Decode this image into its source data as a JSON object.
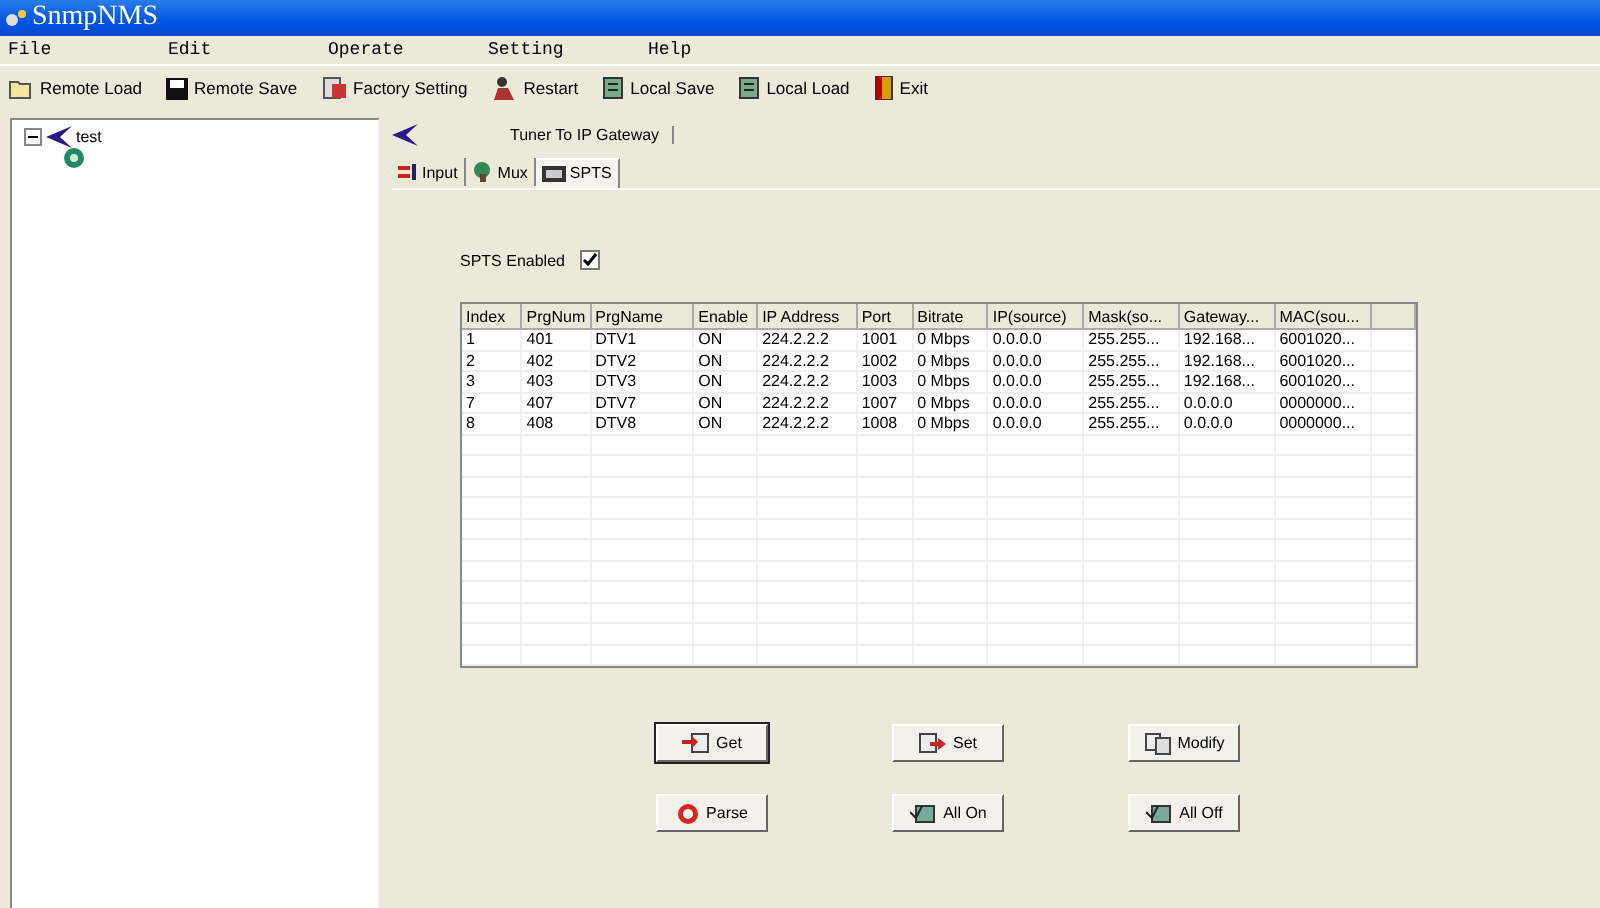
{
  "window": {
    "title": "SnmpNMS"
  },
  "menu": [
    "File",
    "Edit",
    "Operate",
    "Setting",
    "Help"
  ],
  "toolbar": [
    {
      "label": "Remote Load",
      "kind": "folder"
    },
    {
      "label": "Remote Save",
      "kind": "disk"
    },
    {
      "label": "Factory Setting",
      "kind": "factory"
    },
    {
      "label": "Restart",
      "kind": "restart"
    },
    {
      "label": "Local Save",
      "kind": "local"
    },
    {
      "label": "Local Load",
      "kind": "local"
    },
    {
      "label": "Exit",
      "kind": "exit"
    }
  ],
  "tree": [
    {
      "label": "test",
      "expanded": true,
      "children": [
        {
          "kind": "device"
        }
      ]
    }
  ],
  "device_tab": {
    "label": "Tuner To IP Gateway"
  },
  "tabs": [
    {
      "label": "Input",
      "selected": false
    },
    {
      "label": "Mux",
      "selected": false
    },
    {
      "label": "SPTS",
      "selected": true
    }
  ],
  "spts_enabled": {
    "label": "SPTS Enabled",
    "checked": true
  },
  "table": {
    "columns": [
      "Index",
      "PrgNum",
      "PrgName",
      "Enable",
      "IP Address",
      "Port",
      "Bitrate",
      "IP(source)",
      "Mask(so...",
      "Gateway...",
      "MAC(sou..."
    ],
    "rows": [
      [
        "1",
        "401",
        "DTV1",
        "ON",
        "224.2.2.2",
        "1001",
        "0 Mbps",
        "0.0.0.0",
        "255.255...",
        "192.168...",
        "6001020..."
      ],
      [
        "2",
        "402",
        "DTV2",
        "ON",
        "224.2.2.2",
        "1002",
        "0 Mbps",
        "0.0.0.0",
        "255.255...",
        "192.168...",
        "6001020..."
      ],
      [
        "3",
        "403",
        "DTV3",
        "ON",
        "224.2.2.2",
        "1003",
        "0 Mbps",
        "0.0.0.0",
        "255.255...",
        "192.168...",
        "6001020..."
      ],
      [
        "7",
        "407",
        "DTV7",
        "ON",
        "224.2.2.2",
        "1007",
        "0 Mbps",
        "0.0.0.0",
        "255.255...",
        "0.0.0.0",
        "0000000..."
      ],
      [
        "8",
        "408",
        "DTV8",
        "ON",
        "224.2.2.2",
        "1008",
        "0 Mbps",
        "0.0.0.0",
        "255.255...",
        "0.0.0.0",
        "0000000..."
      ]
    ]
  },
  "buttons": [
    {
      "label": "Get",
      "kind": "get",
      "focused": true
    },
    {
      "label": "Set",
      "kind": "set",
      "focused": false
    },
    {
      "label": "Modify",
      "kind": "modify",
      "focused": false
    },
    {
      "label": "Parse",
      "kind": "parse",
      "focused": false
    },
    {
      "label": "All On",
      "kind": "allon",
      "focused": false
    },
    {
      "label": "All Off",
      "kind": "allon",
      "focused": false
    }
  ]
}
